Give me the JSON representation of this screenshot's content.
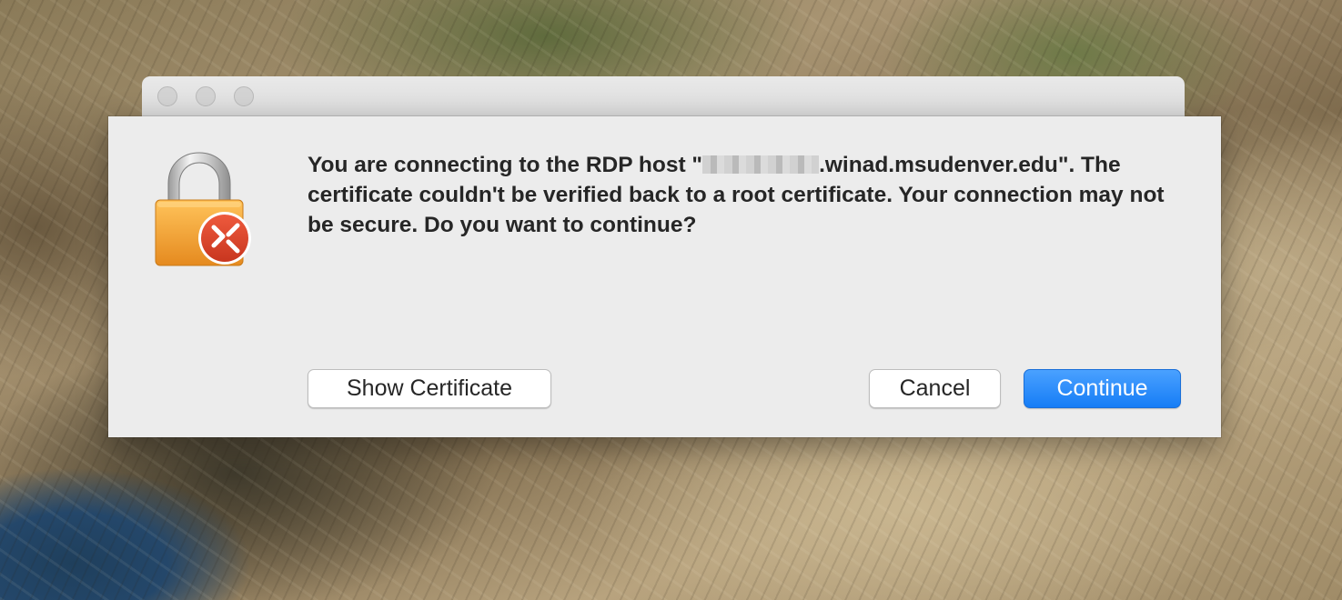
{
  "window": {
    "traffic_lights": [
      "close",
      "minimize",
      "zoom"
    ]
  },
  "dialog": {
    "icon": "lock-with-remote-desktop-badge-icon",
    "message_prefix": "You are connecting to the RDP host \"",
    "host_suffix": ".winad.msudenver.edu",
    "message_suffix": "\". The certificate couldn't be verified back to a root certificate. Your connection may not be secure. Do you want to continue?",
    "buttons": {
      "show_certificate": "Show Certificate",
      "cancel": "Cancel",
      "continue": "Continue"
    }
  },
  "colors": {
    "primary_button": "#167df6",
    "dialog_background": "#ececec",
    "badge_red": "#d9442c",
    "lock_orange": "#f2a43a"
  }
}
